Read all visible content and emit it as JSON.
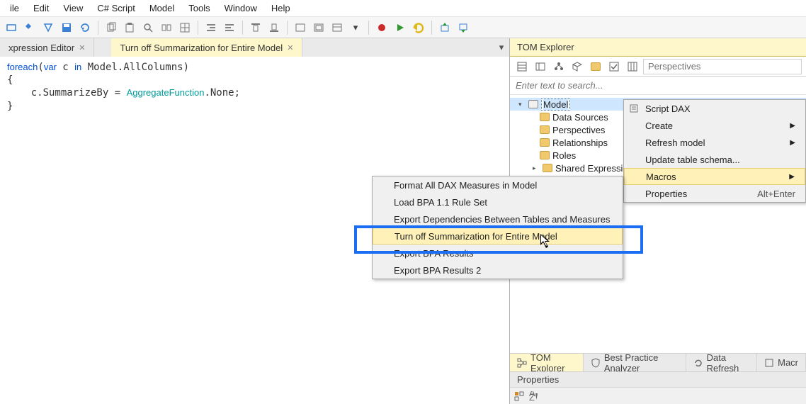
{
  "menu": {
    "file": "ile",
    "edit": "Edit",
    "view": "View",
    "script": "C# Script",
    "model": "Model",
    "tools": "Tools",
    "window": "Window",
    "help": "Help"
  },
  "tabs": {
    "expression_editor": "xpression Editor",
    "macro_tab": "Turn off Summarization for Entire Model"
  },
  "code_html": "<span class='kw-blue'>foreach</span>(<span class='kw-blue'>var</span> c <span class='kw-blue'>in</span> Model.AllColumns)\n{\n    c.SummarizeBy = <span class='kw-teal'>AggregateFunction</span>.None;\n}",
  "explorer": {
    "title": "TOM Explorer",
    "search_placeholder": "Enter text to search...",
    "perspectives_placeholder": "Perspectives",
    "root": "Model",
    "children": [
      "Data Sources",
      "Perspectives",
      "Relationships",
      "Roles",
      "Shared Expressio"
    ]
  },
  "ctx_right": {
    "items": [
      {
        "label": "Script DAX",
        "icon": true
      },
      {
        "label": "Create",
        "arrow": true
      },
      {
        "label": "Refresh model",
        "arrow": true
      },
      {
        "label": "Update table schema..."
      },
      {
        "label": "Macros",
        "arrow": true,
        "hl": true
      },
      {
        "label": "Properties",
        "shortcut": "Alt+Enter"
      }
    ]
  },
  "ctx_left": {
    "items": [
      "Format All DAX Measures in Model",
      "Load BPA 1.1 Rule Set",
      "Export Dependencies Between Tables and Measures",
      "Turn off Summarization for Entire Model",
      "Export BPA Results",
      "Export BPA Results 2"
    ],
    "highlight_index": 3
  },
  "bottom_tabs": {
    "tom": "TOM Explorer",
    "bpa": "Best Practice Analyzer",
    "refresh": "Data Refresh",
    "macros": "Macr"
  },
  "props_title": "Properties"
}
